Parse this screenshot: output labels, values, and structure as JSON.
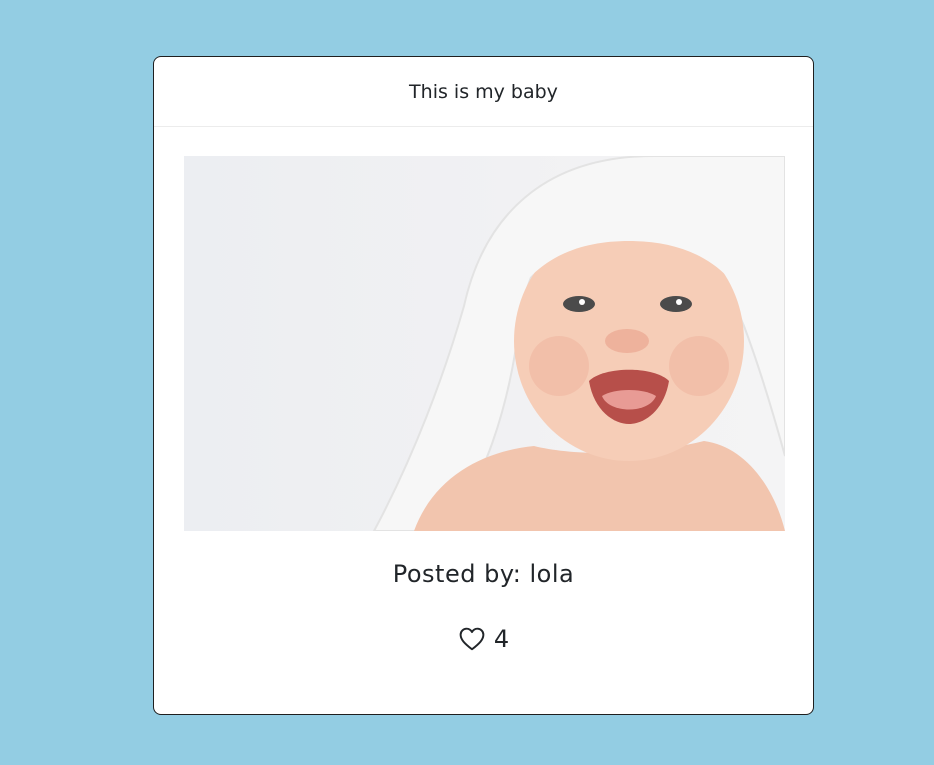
{
  "post": {
    "title": "This is my baby",
    "image_alt": "Laughing baby under a white hooded towel",
    "posted_by_label": "Posted by:",
    "author": "lola",
    "likes": "4"
  },
  "icons": {
    "like": "heart-outline-icon"
  },
  "colors": {
    "page_background": "#93cde3",
    "card_background": "#ffffff",
    "text": "#212529"
  }
}
